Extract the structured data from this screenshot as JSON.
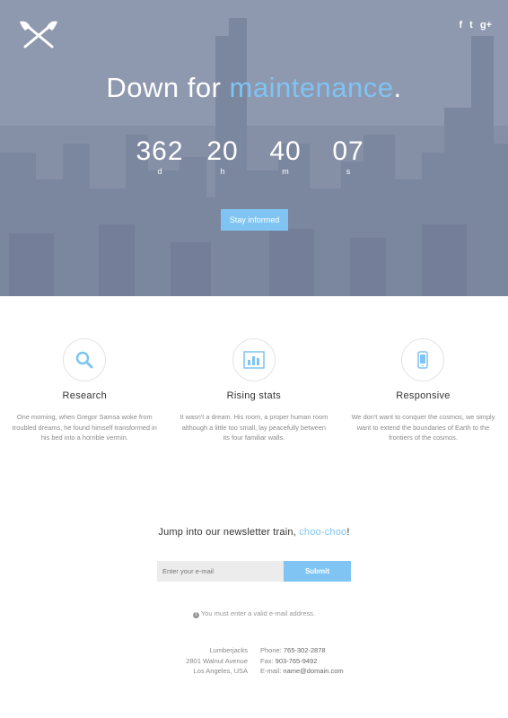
{
  "hero": {
    "headline_prefix": "Down for ",
    "headline_accent": "maintenance",
    "headline_suffix": ".",
    "social": [
      "f",
      "t",
      "g+"
    ],
    "countdown": [
      {
        "value": "362",
        "unit": "d"
      },
      {
        "value": "20",
        "unit": "h"
      },
      {
        "value": "40",
        "unit": "m"
      },
      {
        "value": "07",
        "unit": "s"
      }
    ],
    "button_label": "Stay informed"
  },
  "features": [
    {
      "icon": "search-icon",
      "title": "Research",
      "text": "One morning, when Gregor Samsa woke from troubled dreams, he found himself transformed in his bed into a horrible vermin."
    },
    {
      "icon": "bar-chart-icon",
      "title": "Rising stats",
      "text": "It wasn't a dream. His room, a proper human room although a little too small, lay peacefully between its four familiar walls."
    },
    {
      "icon": "mobile-icon",
      "title": "Responsive",
      "text": "We don't want to conquer the cosmos, we simply want to extend the boundaries of Earth to the frontiers of the cosmos."
    }
  ],
  "newsletter": {
    "title_prefix": "Jump into our newsletter train, ",
    "title_accent": "choo-choo",
    "title_suffix": "!",
    "placeholder": "Enter your e-mail",
    "submit_label": "Submit",
    "notice": "You must enter a valid e-mail address."
  },
  "footer": {
    "address": [
      "Lumberjacks",
      "2801 Walnut Avenue",
      "Los Angeles, USA"
    ],
    "phone_label": "Phone: ",
    "phone": "765-302-2878",
    "fax_label": "Fax: ",
    "fax": "903-765-9492",
    "email_label": "E-mail: ",
    "email": "name@domain.com"
  },
  "colors": {
    "accent": "#7fc4f2"
  }
}
